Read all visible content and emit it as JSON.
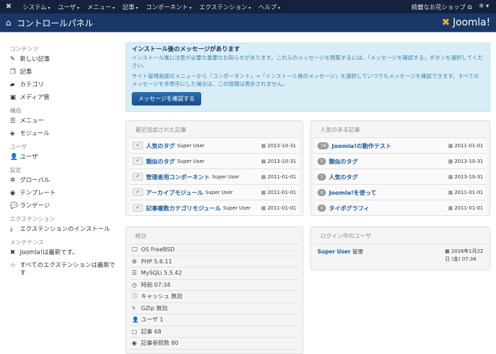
{
  "topnav": {
    "menus": [
      "システム",
      "ユーザ",
      "メニュー",
      "記事",
      "コンポーネント",
      "エクステンション",
      "ヘルプ"
    ],
    "site_link": "綺麗なお花ショップ",
    "site_icon": "external-link-icon",
    "settings_icon": "gear-icon"
  },
  "header": {
    "title": "コントロールパネル",
    "brand": "Joomla!"
  },
  "sidebar": {
    "sections": [
      {
        "title": "コンテンツ",
        "items": [
          {
            "label": "新しい記事",
            "icon": "✎"
          },
          {
            "label": "記事",
            "icon": "❐"
          },
          {
            "label": "カテゴリ",
            "icon": "▰"
          },
          {
            "label": "メディア管",
            "icon": "▣"
          }
        ]
      },
      {
        "title": "構造",
        "items": [
          {
            "label": "メニュー",
            "icon": "☰"
          },
          {
            "label": "モジュール",
            "icon": "◈"
          }
        ]
      },
      {
        "title": "ユーザ",
        "items": [
          {
            "label": "ユーザ",
            "icon": "👤"
          }
        ]
      },
      {
        "title": "設定",
        "items": [
          {
            "label": "グローバル",
            "icon": "✲"
          },
          {
            "label": "テンプレート",
            "icon": "◉"
          },
          {
            "label": "ランゲージ",
            "icon": "💬"
          }
        ]
      },
      {
        "title": "エクステンション",
        "items": [
          {
            "label": "エクステンションのインストール",
            "icon": "⤓"
          }
        ]
      },
      {
        "title": "メンテナンス",
        "items": [
          {
            "label": "Joomla!は最新です。",
            "icon": "✖"
          },
          {
            "label": "すべてのエクステンションは最新です",
            "icon": "☆"
          }
        ]
      }
    ]
  },
  "alert": {
    "title": "インストール後のメッセージがあります",
    "p1": "インストール後に注意が必要な重要なお知らせがあります。これらのメッセージを閲覧するには、「メッセージを確認する」ボタンを選択してください。",
    "p2": "サイト管理画面のメニューから「コンポーネント」→「インストール後のメッセージ」を選択していつでもメッセージを確認できます。すべてのメッセージを非表示にした場合は、この情報は表示されません。",
    "button": "メッセージを確認する"
  },
  "recent": {
    "title": "最近追加された記事",
    "items": [
      {
        "title": "人気のタグ",
        "author": "Super User",
        "date": "2013-10-31"
      },
      {
        "title": "類似のタグ",
        "author": "Super User",
        "date": "2013-10-31"
      },
      {
        "title": "管理者用コンポーネント",
        "author": "Super User",
        "date": "2011-01-01"
      },
      {
        "title": "アーカイブモジュール",
        "author": "Super User",
        "date": "2011-01-01"
      },
      {
        "title": "記事複数カテゴリモジュール",
        "author": "Super User",
        "date": "2011-01-01"
      }
    ]
  },
  "popular": {
    "title": "人気のある記事",
    "items": [
      {
        "hits": "74",
        "title": "Joomla!の動作テスト",
        "date": "2011-01-01"
      },
      {
        "hits": "5",
        "title": "類似のタグ",
        "date": "2013-10-31"
      },
      {
        "hits": "1",
        "title": "人気のタグ",
        "date": "2013-10-31"
      },
      {
        "hits": "0",
        "title": "Joomla!を使って",
        "date": "2011-01-01"
      },
      {
        "hits": "0",
        "title": "タイポグラフィ",
        "date": "2011-01-01"
      }
    ]
  },
  "stats": {
    "title": "統計",
    "items": [
      {
        "icon": "🖵",
        "text": "OS FreeBSD"
      },
      {
        "icon": "⚙",
        "text": "PHP 5.6.11"
      },
      {
        "icon": "☰",
        "text": "MySQLi 5.5.42"
      },
      {
        "icon": "◷",
        "text": "時刻 07:34"
      },
      {
        "icon": "ⓘ",
        "text": "キャッシュ 無効"
      },
      {
        "icon": "ϟ",
        "text": "GZip 無効"
      },
      {
        "icon": "👤",
        "text": "ユーザ 1"
      },
      {
        "icon": "▢",
        "text": "記事 68"
      },
      {
        "icon": "◉",
        "text": "記事参照数 80"
      }
    ]
  },
  "logged": {
    "title": "ログイン中のユーザ",
    "user": "Super User",
    "role": "管理",
    "date1": "2016年1月22",
    "date2": "日 (金) 07:34"
  }
}
